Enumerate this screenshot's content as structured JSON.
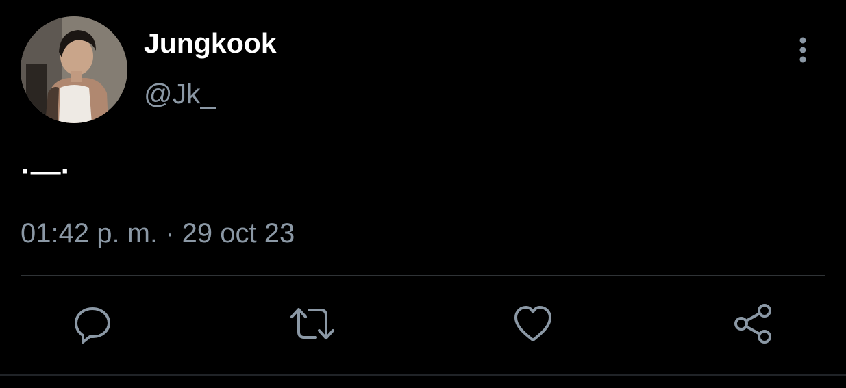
{
  "tweet": {
    "display_name": "Jungkook",
    "handle": "@Jk_",
    "text": "·—·",
    "timestamp": "01:42 p. m. · 29 oct 23"
  },
  "icons": {
    "more": "more-vertical-icon",
    "reply": "reply-icon",
    "retweet": "retweet-icon",
    "like": "heart-icon",
    "share": "share-icon"
  },
  "colors": {
    "background": "#000000",
    "primary_text": "#ffffff",
    "secondary_text": "#8b98a5",
    "divider": "#2f3336"
  }
}
